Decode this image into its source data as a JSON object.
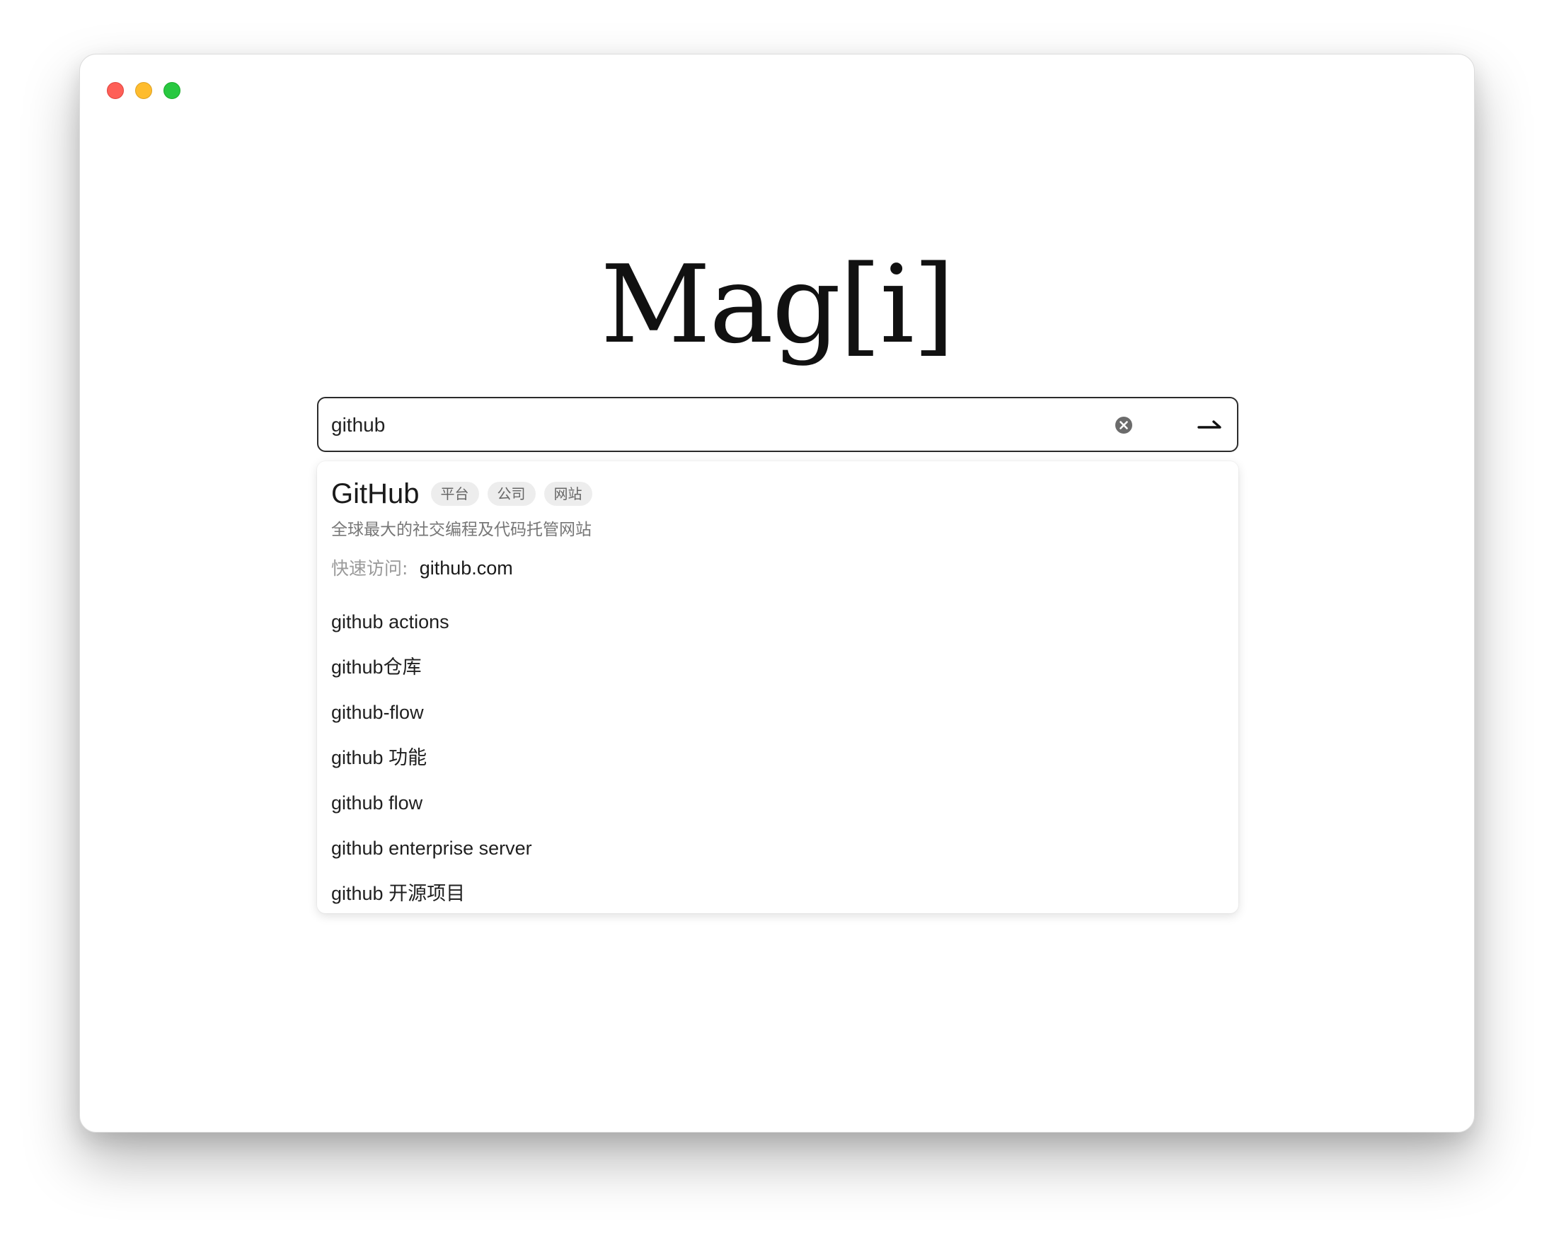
{
  "window": {
    "controls": [
      "close",
      "minimize",
      "zoom"
    ]
  },
  "logo": {
    "text": "Mag[i]"
  },
  "search": {
    "value": "github",
    "clear_icon": "clear-circle-icon",
    "submit_icon": "arrow-right-icon"
  },
  "entity": {
    "name": "GitHub",
    "tags": [
      "平台",
      "公司",
      "网站"
    ],
    "description": "全球最大的社交编程及代码托管网站",
    "quick_access_label": "快速访问:",
    "quick_access_link": "github.com"
  },
  "suggestions": [
    "github actions",
    "github仓库",
    "github-flow",
    "github 功能",
    "github flow",
    "github enterprise server",
    "github 开源项目"
  ],
  "colors": {
    "close": "#fe5f57",
    "minimize": "#febc2e",
    "zoom": "#28c840",
    "tag_bg": "#ededed",
    "muted_text": "#777777"
  }
}
